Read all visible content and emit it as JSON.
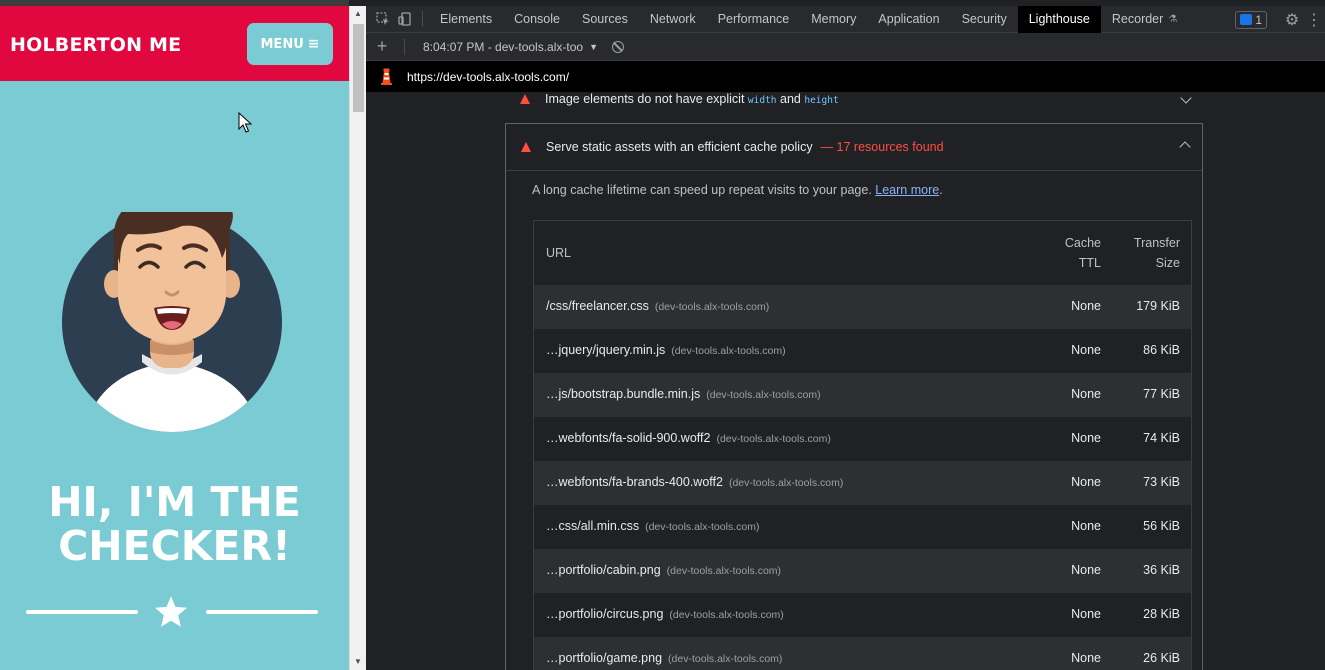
{
  "page": {
    "brand": "HOLBERTON ME",
    "menu_label": "MENU",
    "menu_icon": "bars-icon",
    "headline_line1": "HI, I'M THE",
    "headline_line2": "CHECKER!",
    "colors": {
      "navbar": "#E0083F",
      "hero": "#7ACBD3"
    }
  },
  "devtools": {
    "tabs": [
      "Elements",
      "Console",
      "Sources",
      "Network",
      "Performance",
      "Memory",
      "Application",
      "Security",
      "Lighthouse",
      "Recorder"
    ],
    "active_tab": "Lighthouse",
    "issues_count": "1",
    "report_label": "8:04:07 PM - dev-tools.alx-too",
    "url": "https://dev-tools.alx-tools.com/"
  },
  "audits": {
    "image_elements": {
      "title_prefix": "Image elements do not have explicit",
      "code1": "width",
      "and": "and",
      "code2": "height"
    },
    "cache_policy": {
      "title": "Serve static assets with an efficient cache policy",
      "display_value": "— 17 resources found",
      "description": "A long cache lifetime can speed up repeat visits to your page.",
      "learn_more": "Learn more",
      "headers": {
        "url": "URL",
        "ttl_line1": "Cache",
        "ttl_line2": "TTL",
        "size_line1": "Transfer",
        "size_line2": "Size"
      },
      "rows": [
        {
          "url": "/css/freelancer.css",
          "host": "(dev-tools.alx-tools.com)",
          "ttl": "None",
          "size": "179 KiB"
        },
        {
          "url": "…jquery/jquery.min.js",
          "host": "(dev-tools.alx-tools.com)",
          "ttl": "None",
          "size": "86 KiB"
        },
        {
          "url": "…js/bootstrap.bundle.min.js",
          "host": "(dev-tools.alx-tools.com)",
          "ttl": "None",
          "size": "77 KiB"
        },
        {
          "url": "…webfonts/fa-solid-900.woff2",
          "host": "(dev-tools.alx-tools.com)",
          "ttl": "None",
          "size": "74 KiB"
        },
        {
          "url": "…webfonts/fa-brands-400.woff2",
          "host": "(dev-tools.alx-tools.com)",
          "ttl": "None",
          "size": "73 KiB"
        },
        {
          "url": "…css/all.min.css",
          "host": "(dev-tools.alx-tools.com)",
          "ttl": "None",
          "size": "56 KiB"
        },
        {
          "url": "…portfolio/cabin.png",
          "host": "(dev-tools.alx-tools.com)",
          "ttl": "None",
          "size": "36 KiB"
        },
        {
          "url": "…portfolio/circus.png",
          "host": "(dev-tools.alx-tools.com)",
          "ttl": "None",
          "size": "28 KiB"
        },
        {
          "url": "…portfolio/game.png",
          "host": "(dev-tools.alx-tools.com)",
          "ttl": "None",
          "size": "26 KiB"
        }
      ]
    }
  }
}
